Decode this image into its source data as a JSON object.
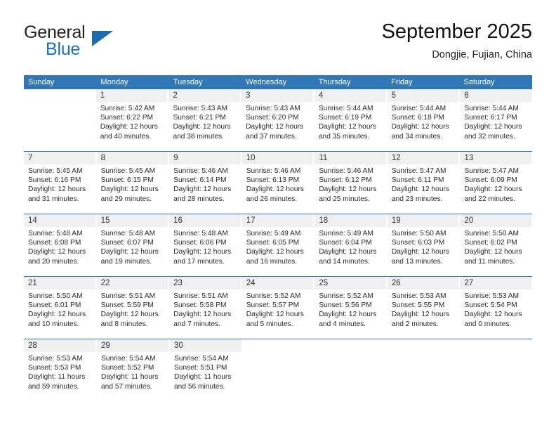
{
  "logo": {
    "word_one": "General",
    "word_two": "Blue",
    "triangle_icon": "triangle-icon"
  },
  "header": {
    "month_title": "September 2025",
    "location": "Dongjie, Fujian, China"
  },
  "colors": {
    "header_blue": "#2f77b6",
    "logo_blue": "#1573ba",
    "day_strip_gray": "#f0f0f0",
    "text_dark": "#2b2b2b"
  },
  "calendar": {
    "weekdays": [
      "Sunday",
      "Monday",
      "Tuesday",
      "Wednesday",
      "Thursday",
      "Friday",
      "Saturday"
    ],
    "weeks": [
      [
        {
          "day": "",
          "lines": []
        },
        {
          "day": "1",
          "lines": [
            "Sunrise: 5:42 AM",
            "Sunset: 6:22 PM",
            "Daylight: 12 hours",
            "and 40 minutes."
          ]
        },
        {
          "day": "2",
          "lines": [
            "Sunrise: 5:43 AM",
            "Sunset: 6:21 PM",
            "Daylight: 12 hours",
            "and 38 minutes."
          ]
        },
        {
          "day": "3",
          "lines": [
            "Sunrise: 5:43 AM",
            "Sunset: 6:20 PM",
            "Daylight: 12 hours",
            "and 37 minutes."
          ]
        },
        {
          "day": "4",
          "lines": [
            "Sunrise: 5:44 AM",
            "Sunset: 6:19 PM",
            "Daylight: 12 hours",
            "and 35 minutes."
          ]
        },
        {
          "day": "5",
          "lines": [
            "Sunrise: 5:44 AM",
            "Sunset: 6:18 PM",
            "Daylight: 12 hours",
            "and 34 minutes."
          ]
        },
        {
          "day": "6",
          "lines": [
            "Sunrise: 5:44 AM",
            "Sunset: 6:17 PM",
            "Daylight: 12 hours",
            "and 32 minutes."
          ]
        }
      ],
      [
        {
          "day": "7",
          "lines": [
            "Sunrise: 5:45 AM",
            "Sunset: 6:16 PM",
            "Daylight: 12 hours",
            "and 31 minutes."
          ]
        },
        {
          "day": "8",
          "lines": [
            "Sunrise: 5:45 AM",
            "Sunset: 6:15 PM",
            "Daylight: 12 hours",
            "and 29 minutes."
          ]
        },
        {
          "day": "9",
          "lines": [
            "Sunrise: 5:46 AM",
            "Sunset: 6:14 PM",
            "Daylight: 12 hours",
            "and 28 minutes."
          ]
        },
        {
          "day": "10",
          "lines": [
            "Sunrise: 5:46 AM",
            "Sunset: 6:13 PM",
            "Daylight: 12 hours",
            "and 26 minutes."
          ]
        },
        {
          "day": "11",
          "lines": [
            "Sunrise: 5:46 AM",
            "Sunset: 6:12 PM",
            "Daylight: 12 hours",
            "and 25 minutes."
          ]
        },
        {
          "day": "12",
          "lines": [
            "Sunrise: 5:47 AM",
            "Sunset: 6:11 PM",
            "Daylight: 12 hours",
            "and 23 minutes."
          ]
        },
        {
          "day": "13",
          "lines": [
            "Sunrise: 5:47 AM",
            "Sunset: 6:09 PM",
            "Daylight: 12 hours",
            "and 22 minutes."
          ]
        }
      ],
      [
        {
          "day": "14",
          "lines": [
            "Sunrise: 5:48 AM",
            "Sunset: 6:08 PM",
            "Daylight: 12 hours",
            "and 20 minutes."
          ]
        },
        {
          "day": "15",
          "lines": [
            "Sunrise: 5:48 AM",
            "Sunset: 6:07 PM",
            "Daylight: 12 hours",
            "and 19 minutes."
          ]
        },
        {
          "day": "16",
          "lines": [
            "Sunrise: 5:48 AM",
            "Sunset: 6:06 PM",
            "Daylight: 12 hours",
            "and 17 minutes."
          ]
        },
        {
          "day": "17",
          "lines": [
            "Sunrise: 5:49 AM",
            "Sunset: 6:05 PM",
            "Daylight: 12 hours",
            "and 16 minutes."
          ]
        },
        {
          "day": "18",
          "lines": [
            "Sunrise: 5:49 AM",
            "Sunset: 6:04 PM",
            "Daylight: 12 hours",
            "and 14 minutes."
          ]
        },
        {
          "day": "19",
          "lines": [
            "Sunrise: 5:50 AM",
            "Sunset: 6:03 PM",
            "Daylight: 12 hours",
            "and 13 minutes."
          ]
        },
        {
          "day": "20",
          "lines": [
            "Sunrise: 5:50 AM",
            "Sunset: 6:02 PM",
            "Daylight: 12 hours",
            "and 11 minutes."
          ]
        }
      ],
      [
        {
          "day": "21",
          "lines": [
            "Sunrise: 5:50 AM",
            "Sunset: 6:01 PM",
            "Daylight: 12 hours",
            "and 10 minutes."
          ]
        },
        {
          "day": "22",
          "lines": [
            "Sunrise: 5:51 AM",
            "Sunset: 5:59 PM",
            "Daylight: 12 hours",
            "and 8 minutes."
          ]
        },
        {
          "day": "23",
          "lines": [
            "Sunrise: 5:51 AM",
            "Sunset: 5:58 PM",
            "Daylight: 12 hours",
            "and 7 minutes."
          ]
        },
        {
          "day": "24",
          "lines": [
            "Sunrise: 5:52 AM",
            "Sunset: 5:57 PM",
            "Daylight: 12 hours",
            "and 5 minutes."
          ]
        },
        {
          "day": "25",
          "lines": [
            "Sunrise: 5:52 AM",
            "Sunset: 5:56 PM",
            "Daylight: 12 hours",
            "and 4 minutes."
          ]
        },
        {
          "day": "26",
          "lines": [
            "Sunrise: 5:53 AM",
            "Sunset: 5:55 PM",
            "Daylight: 12 hours",
            "and 2 minutes."
          ]
        },
        {
          "day": "27",
          "lines": [
            "Sunrise: 5:53 AM",
            "Sunset: 5:54 PM",
            "Daylight: 12 hours",
            "and 0 minutes."
          ]
        }
      ],
      [
        {
          "day": "28",
          "lines": [
            "Sunrise: 5:53 AM",
            "Sunset: 5:53 PM",
            "Daylight: 11 hours",
            "and 59 minutes."
          ]
        },
        {
          "day": "29",
          "lines": [
            "Sunrise: 5:54 AM",
            "Sunset: 5:52 PM",
            "Daylight: 11 hours",
            "and 57 minutes."
          ]
        },
        {
          "day": "30",
          "lines": [
            "Sunrise: 5:54 AM",
            "Sunset: 5:51 PM",
            "Daylight: 11 hours",
            "and 56 minutes."
          ]
        },
        {
          "day": "",
          "lines": []
        },
        {
          "day": "",
          "lines": []
        },
        {
          "day": "",
          "lines": []
        },
        {
          "day": "",
          "lines": []
        }
      ]
    ]
  }
}
